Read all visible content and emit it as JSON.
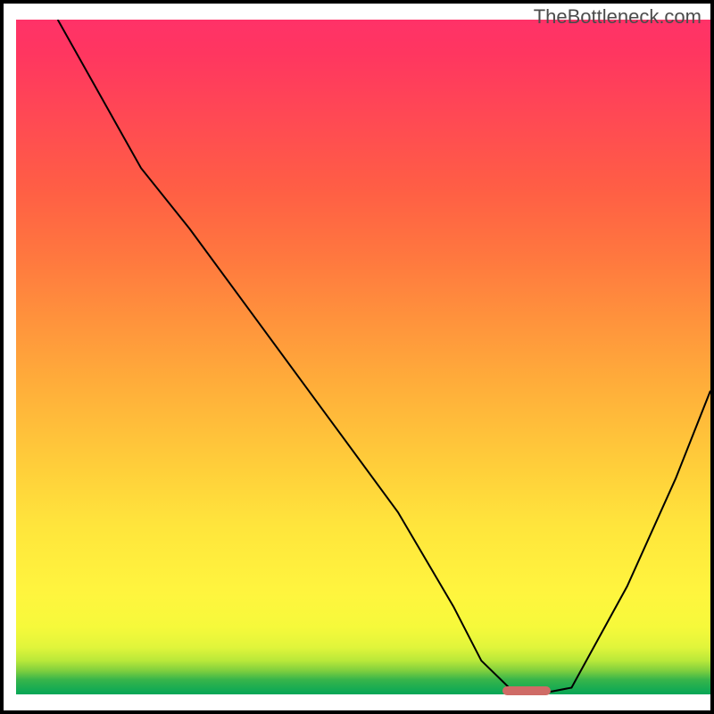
{
  "watermark": "TheBottleneck.com",
  "chart_data": {
    "type": "line",
    "title": "",
    "xlabel": "",
    "ylabel": "",
    "xlim": [
      0,
      100
    ],
    "ylim": [
      0,
      100
    ],
    "grid": false,
    "legend": false,
    "background": "rainbow-gradient (green bottom → red top)",
    "series": [
      {
        "name": "bottleneck-curve",
        "color": "#000000",
        "x": [
          6,
          18,
          25,
          35,
          45,
          55,
          63,
          67,
          71,
          75,
          80,
          88,
          95,
          100
        ],
        "values": [
          100,
          78,
          69,
          55,
          41,
          27,
          13,
          5,
          1,
          0,
          1,
          16,
          32,
          45
        ]
      }
    ],
    "marker": {
      "name": "optimal-range",
      "color": "#cf6b66",
      "x_start": 70,
      "x_end": 77,
      "y": 0.5
    }
  }
}
